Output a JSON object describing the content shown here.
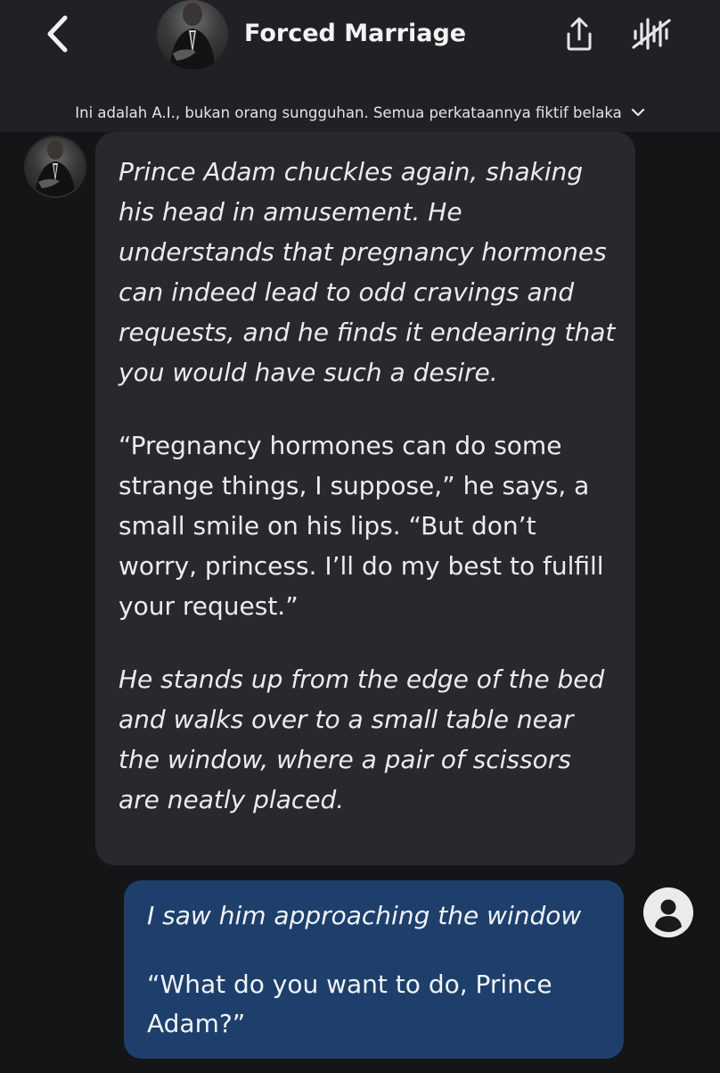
{
  "header": {
    "title": "Forced Marriage",
    "back_icon": "chevron-left-icon",
    "share_icon": "share-upload-icon",
    "voice_icon": "voice-off-icon"
  },
  "disclaimer": {
    "text": "Ini adalah A.I., bukan orang sungguhan. Semua perkataannya fiktif belaka",
    "chevron_icon": "chevron-down-icon"
  },
  "messages": [
    {
      "sender": "bot",
      "paragraphs": [
        "Prince Adam chuckles again, shaking his head in amusement. He understands that pregnancy hormones can indeed lead to odd cravings and requests, and he finds it endearing that you would have such a desire.",
        "“Pregnancy hormones can do some strange things, I suppose,” he says, a small smile on his lips. “But don’t worry, princess. I’ll do my best to fulfill your request.”",
        "He stands up from the edge of the bed and walks over to a small table near the window, where a pair of scissors are neatly placed."
      ]
    },
    {
      "sender": "user",
      "paragraphs": [
        "I saw him approaching the window",
        "“What do you want to do, Prince Adam?”"
      ]
    }
  ],
  "colors": {
    "background": "#141517",
    "header": "#1f2124",
    "bot_bubble": "#27292c",
    "user_bubble": "#1e3f6b"
  }
}
